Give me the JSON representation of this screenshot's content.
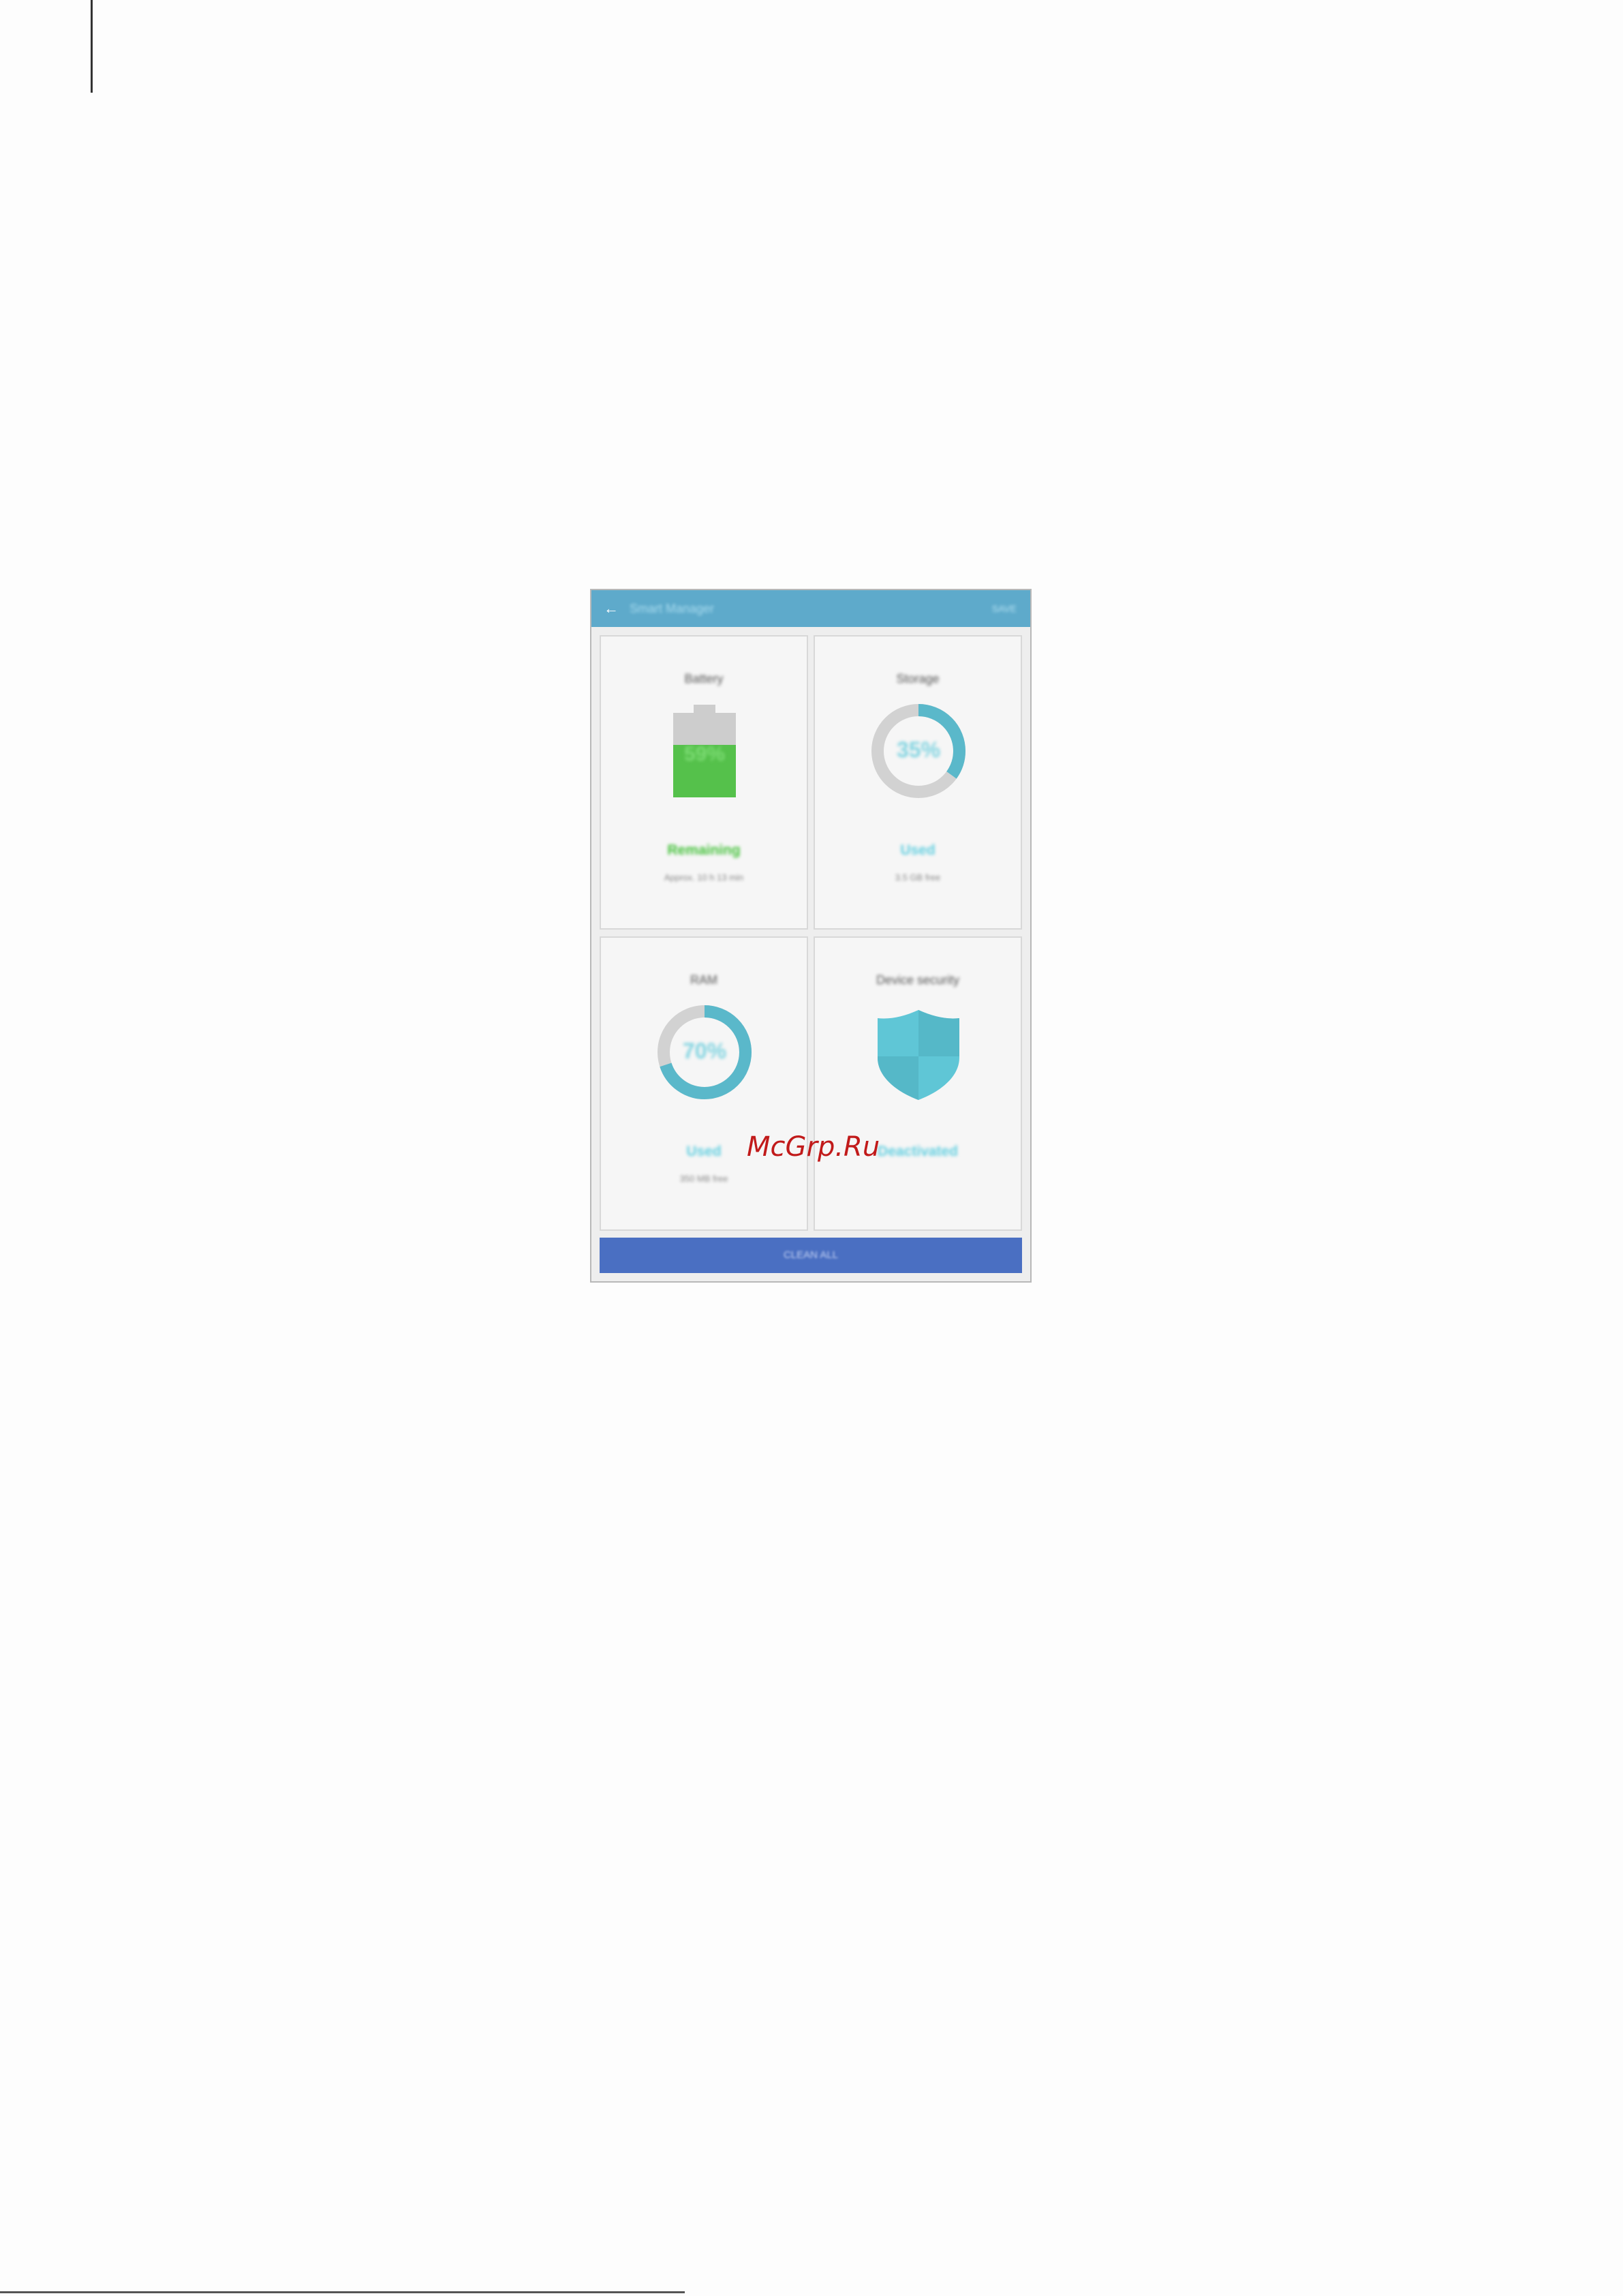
{
  "app": {
    "title": "Smart Manager",
    "action": "SAVE"
  },
  "battery": {
    "title": "Battery",
    "percent_label": "59%",
    "level": 0.62,
    "status": "Remaining",
    "detail": "Approx. 10 h 13 min"
  },
  "storage": {
    "title": "Storage",
    "percent_label": "35%",
    "fraction": 0.35,
    "status": "Used",
    "detail": "3.5 GB free"
  },
  "ram": {
    "title": "RAM",
    "percent_label": "70%",
    "fraction": 0.7,
    "status": "Used",
    "detail": "350 MB free"
  },
  "security": {
    "title": "Device security",
    "status": "Deactivated"
  },
  "clean_button": "CLEAN ALL",
  "watermark": "McGrp.Ru",
  "colors": {
    "appbar": "#5eaacb",
    "battery_green": "#55c14b",
    "ring_accent": "#5ab8ca",
    "ring_track": "#d2d2d2",
    "button": "#4a6fc2",
    "shield_light": "#5fc6d6",
    "shield_dark": "#4fb2c2"
  }
}
